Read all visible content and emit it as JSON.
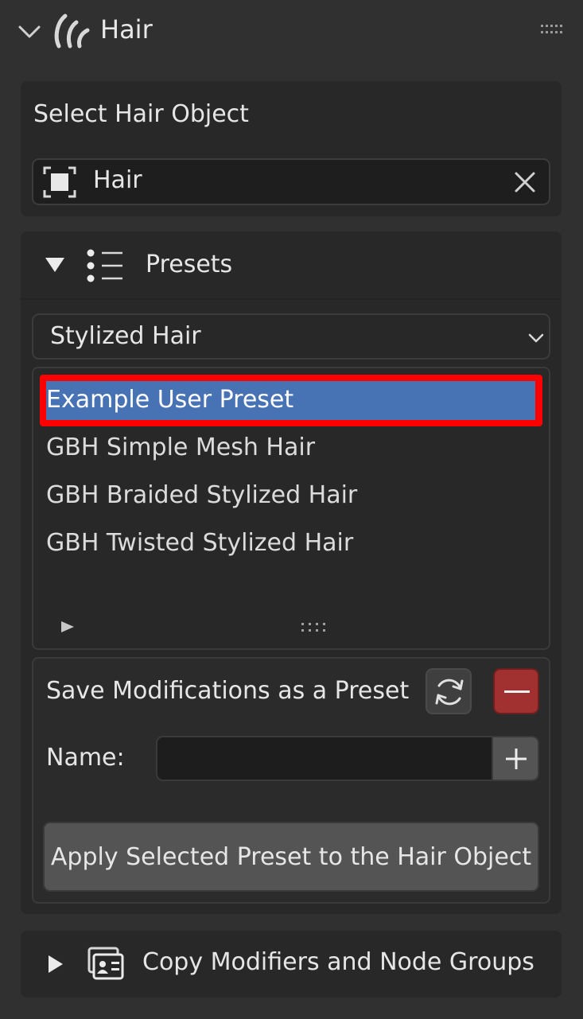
{
  "header": {
    "title": "Hair",
    "icon": "hair-strands-icon"
  },
  "select_panel": {
    "label": "Select Hair Object",
    "object_field": {
      "value": "Hair",
      "icon": "object-box-icon",
      "clear_icon": "close-icon"
    }
  },
  "presets_panel": {
    "title": "Presets",
    "icon": "list-icon",
    "category_dropdown": {
      "selected": "Stylized Hair"
    },
    "list": {
      "items": [
        {
          "label": "Example User Preset",
          "selected": true
        },
        {
          "label": "GBH Simple Mesh Hair",
          "selected": false
        },
        {
          "label": "GBH Braided Stylized Hair",
          "selected": false
        },
        {
          "label": "GBH Twisted Stylized Hair",
          "selected": false
        }
      ]
    },
    "save": {
      "label": "Save Modifications as a Preset",
      "name_label": "Name:",
      "name_value": ""
    },
    "apply_button": "Apply Selected Preset to the Hair Object"
  },
  "copy_panel": {
    "title": "Copy Modifiers and Node Groups",
    "icon": "id-card-icon"
  },
  "colors": {
    "background": "#303030",
    "panel": "#282828",
    "selection": "#4772b3",
    "highlight_border": "#ff0000",
    "danger": "#a13030"
  }
}
